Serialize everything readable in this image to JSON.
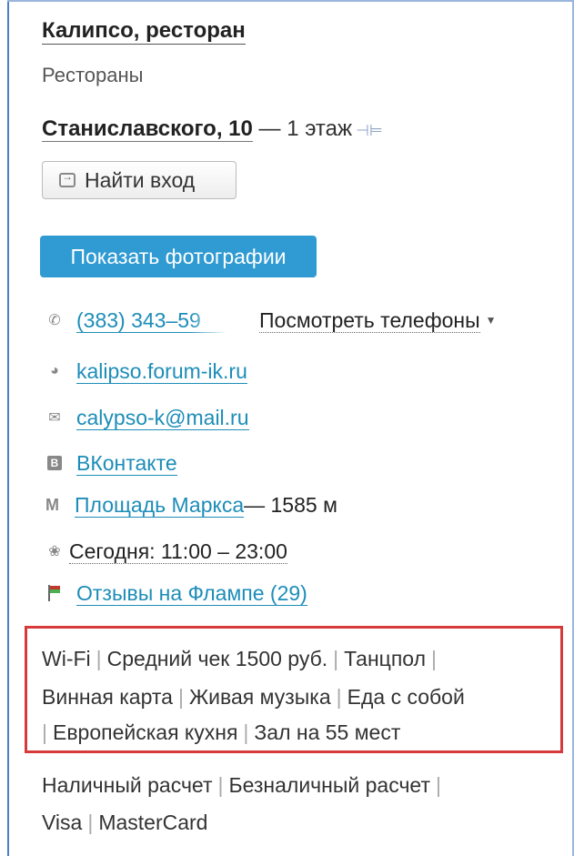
{
  "place": {
    "title": "Калипсо, ресторан",
    "category": "Рестораны",
    "address_street": "Станиславского, 10",
    "address_rest": " — 1 этаж"
  },
  "buttons": {
    "find_entrance": "Найти вход",
    "show_photos": "Показать фотографии"
  },
  "contacts": {
    "phone": "(383) 343–59",
    "show_phones": "Посмотреть телефоны",
    "website": "kalipso.forum-ik.ru",
    "email": "calypso-k@mail.ru",
    "vk": "ВКонтакте",
    "metro_station": "Площадь Маркса",
    "metro_distance": " — 1585 м",
    "hours": "Сегодня: 11:00 – 23:00",
    "reviews": "Отзывы на Флампе (29)"
  },
  "icons": {
    "phone": "phone-icon",
    "globe": "globe-icon",
    "mail": "mail-icon",
    "vk": "vk-icon",
    "metro": "metro-icon",
    "clock": "clock-icon",
    "flag": "flamp-flag-icon"
  },
  "features": {
    "line1": [
      "Wi-Fi",
      "Средний чек 1500 руб.",
      "Танцпол"
    ],
    "line2": [
      "Винная карта",
      "Живая музыка",
      "Еда с собой"
    ],
    "line3": [
      "Европейская кухня",
      "Зал на 55 мест"
    ]
  },
  "payments": {
    "line1": [
      "Наличный расчет",
      "Безналичный расчет"
    ],
    "line2": [
      "Visa",
      "MasterCard"
    ]
  },
  "colors": {
    "accent": "#2f9bd2",
    "link": "#1d8db8",
    "highlight_border": "#d63a3a"
  }
}
